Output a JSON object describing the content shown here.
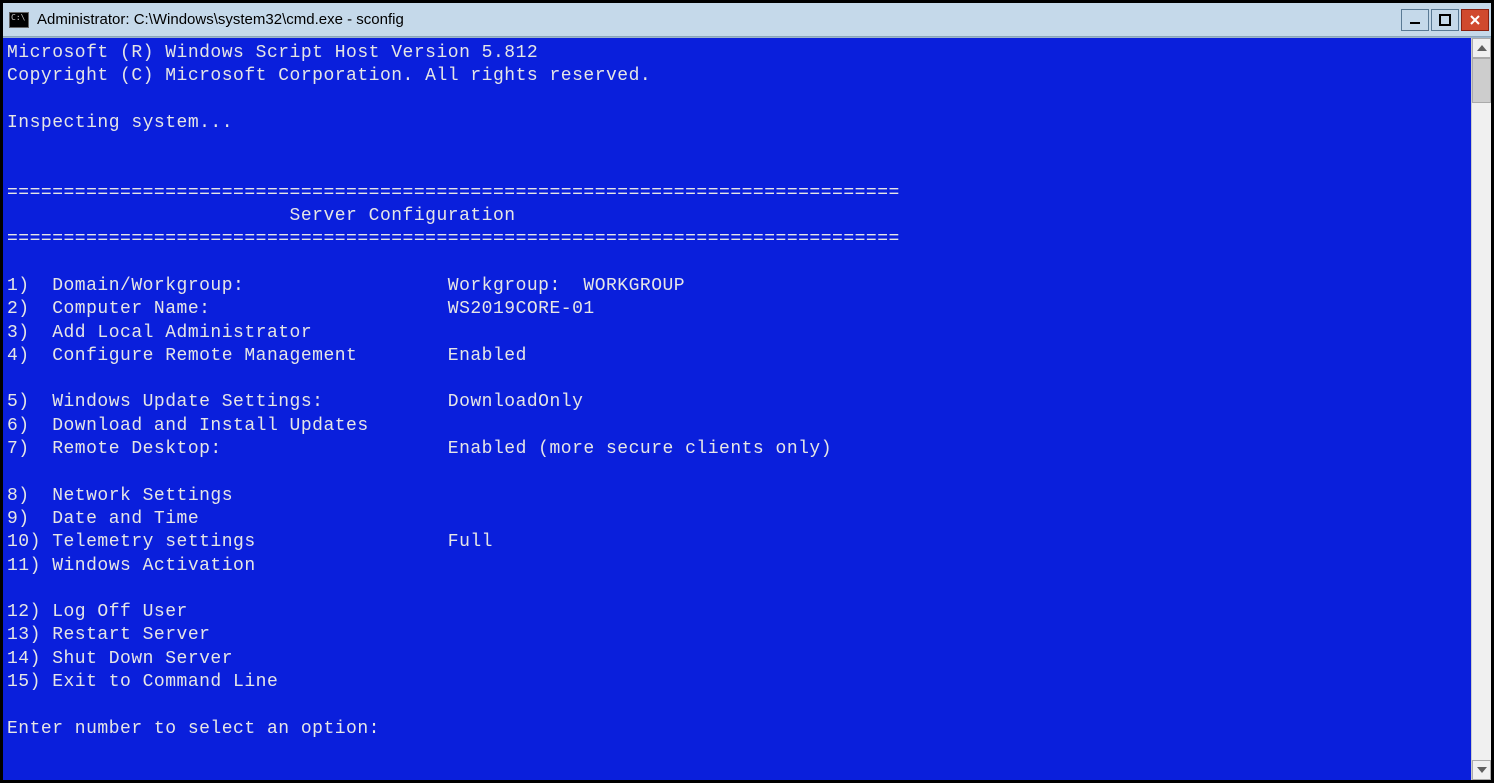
{
  "window": {
    "title": "Administrator: C:\\Windows\\system32\\cmd.exe - sconfig"
  },
  "terminal": {
    "header1": "Microsoft (R) Windows Script Host Version 5.812",
    "header2": "Copyright (C) Microsoft Corporation. All rights reserved.",
    "inspecting": "Inspecting system...",
    "divider": "===============================================================================",
    "title_line": "                         Server Configuration",
    "menu": [
      {
        "num": "1)",
        "label": "Domain/Workgroup:",
        "value": "Workgroup:  WORKGROUP"
      },
      {
        "num": "2)",
        "label": "Computer Name:",
        "value": "WS2019CORE-01"
      },
      {
        "num": "3)",
        "label": "Add Local Administrator",
        "value": ""
      },
      {
        "num": "4)",
        "label": "Configure Remote Management",
        "value": "Enabled"
      },
      {
        "num": "",
        "label": "",
        "value": ""
      },
      {
        "num": "5)",
        "label": "Windows Update Settings:",
        "value": "DownloadOnly"
      },
      {
        "num": "6)",
        "label": "Download and Install Updates",
        "value": ""
      },
      {
        "num": "7)",
        "label": "Remote Desktop:",
        "value": "Enabled (more secure clients only)"
      },
      {
        "num": "",
        "label": "",
        "value": ""
      },
      {
        "num": "8)",
        "label": "Network Settings",
        "value": ""
      },
      {
        "num": "9)",
        "label": "Date and Time",
        "value": ""
      },
      {
        "num": "10)",
        "label": "Telemetry settings",
        "value": "Full"
      },
      {
        "num": "11)",
        "label": "Windows Activation",
        "value": ""
      },
      {
        "num": "",
        "label": "",
        "value": ""
      },
      {
        "num": "12)",
        "label": "Log Off User",
        "value": ""
      },
      {
        "num": "13)",
        "label": "Restart Server",
        "value": ""
      },
      {
        "num": "14)",
        "label": "Shut Down Server",
        "value": ""
      },
      {
        "num": "15)",
        "label": "Exit to Command Line",
        "value": ""
      }
    ],
    "prompt": "Enter number to select an option:",
    "label_col_width": 39
  }
}
